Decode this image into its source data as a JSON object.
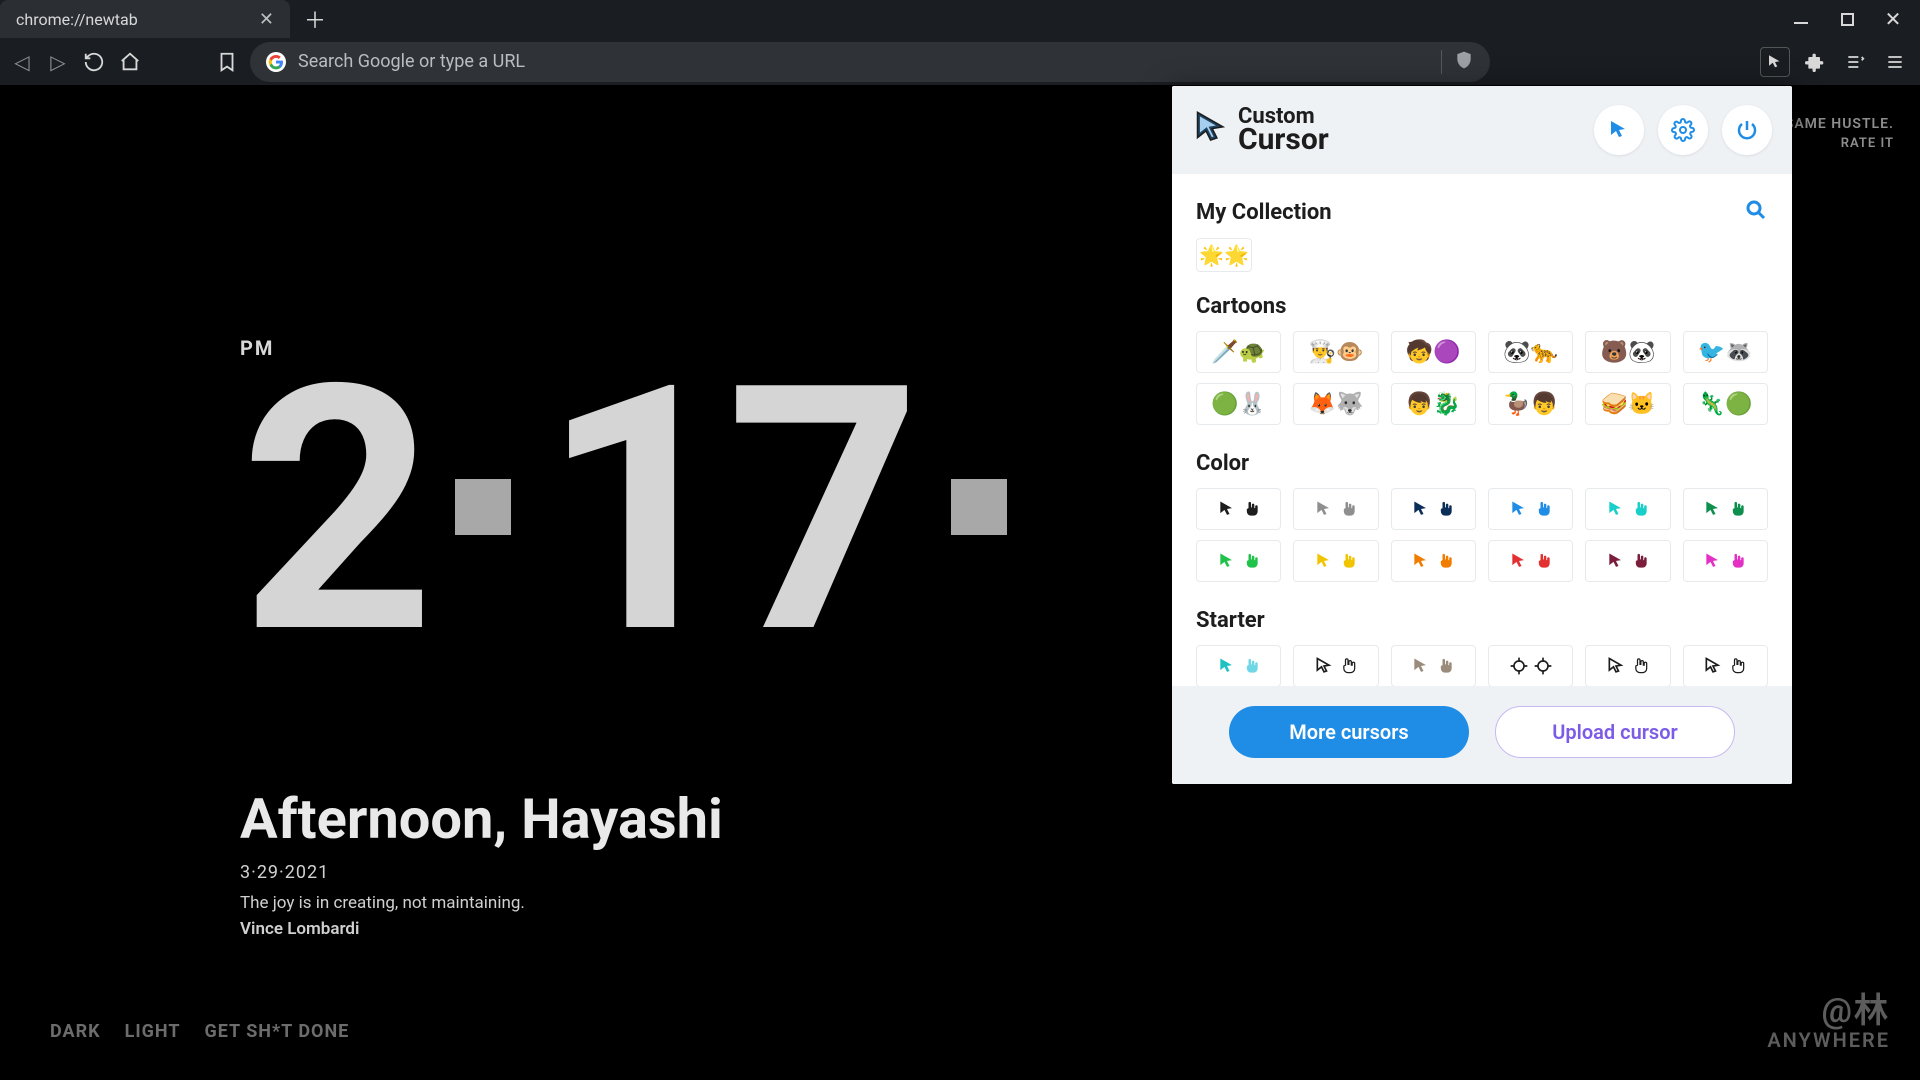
{
  "tab": {
    "title": "chrome://newtab"
  },
  "addressbar": {
    "placeholder": "Search Google or type a URL"
  },
  "page": {
    "ampm": "PM",
    "hour": "2",
    "minute": "17",
    "greeting": "Afternoon, Hayashi",
    "date": "3·29·2021",
    "quote": "The joy is in creating, not maintaining.",
    "author": "Vince Lombardi",
    "themes": {
      "dark": "DARK",
      "light": "LIGHT",
      "gsd": "GET SH*T DONE"
    },
    "top_right_line1": "SAME HUSTLE.",
    "top_right_line2": "RATE IT",
    "watermark_line1": "@林",
    "watermark_line2": "ANYWHERE"
  },
  "ext": {
    "logo_line1": "Custom",
    "logo_line2": "Cursor",
    "my_collection_title": "My Collection",
    "cartoons_title": "Cartoons",
    "color_title": "Color",
    "starter_title": "Starter",
    "more_btn": "More cursors",
    "upload_btn": "Upload cursor",
    "my_collection_item": "🌟🌟",
    "cartoons_row1": [
      "🗡️🐢",
      "👨‍🍳🐵",
      "🧒🟣",
      "🐼🐆",
      "🐻🐼",
      "🐦🦝"
    ],
    "cartoons_row2": [
      "🟢🐰",
      "🦊🐺",
      "👦🐉",
      "🦆👦",
      "🥪🐱",
      "🦎🟢"
    ],
    "colors_row1": [
      "#1d1d1d",
      "#8f8f8f",
      "#0b2e59",
      "#1f8de6",
      "#18d0c9",
      "#0f8f4d"
    ],
    "colors_row2": [
      "#21c24a",
      "#f2c400",
      "#f07c00",
      "#e33030",
      "#7a1e3c",
      "#e530c6"
    ],
    "starter_items": [
      {
        "arrow": "#1fc2c2",
        "hand": "#6fd7e6"
      },
      {
        "arrow": "#1d1d1d",
        "hand": "#1d1d1d",
        "outline": true
      },
      {
        "arrow": "#9a8b7a",
        "hand": "#9a8b7a"
      },
      {
        "type": "crosshair"
      },
      {
        "arrow": "#1d1d1d",
        "hand": "#1d1d1d",
        "outline": true
      },
      {
        "arrow": "#1d1d1d",
        "hand": "#1d1d1d",
        "outline": true,
        "rock": true
      }
    ]
  }
}
